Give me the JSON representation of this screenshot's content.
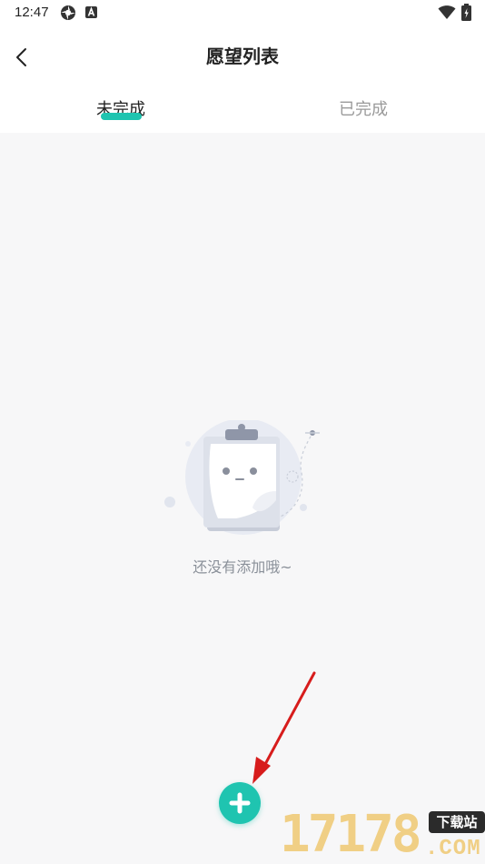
{
  "status_bar": {
    "time": "12:47"
  },
  "header": {
    "title": "愿望列表",
    "back_icon": "chevron-left-icon"
  },
  "tabs": [
    {
      "label": "未完成",
      "active": true
    },
    {
      "label": "已完成",
      "active": false
    }
  ],
  "empty_state": {
    "message": "还没有添加哦~",
    "illustration": "clipboard-face-illustration"
  },
  "fab": {
    "icon": "plus-icon",
    "color": "#1fc4b0"
  },
  "annotation": {
    "arrow_color": "#d71c1c"
  },
  "watermark": {
    "digits": "17178",
    "badge": "下载站",
    "domain": ".COM"
  },
  "colors": {
    "accent": "#1fc4b0",
    "background": "#f7f7f8",
    "muted_text": "#8a9099"
  }
}
